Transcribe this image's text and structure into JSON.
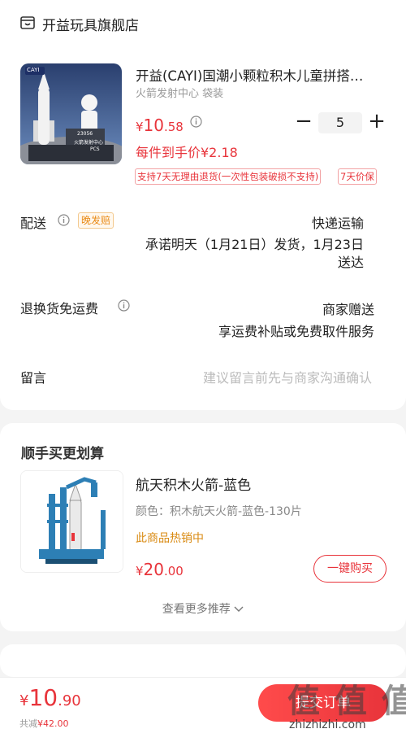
{
  "shop": {
    "name": "开益玩具旗舰店",
    "icon": "shop-icon"
  },
  "product": {
    "title": "开益(CAYI)国潮小颗粒积木儿童拼搭…",
    "spec": "火箭发射中心 袋装",
    "currency": "¥",
    "price_int": "10",
    "price_dec": ".58",
    "quantity": "5",
    "each_price": "每件到手价¥2.18",
    "badge_return": "支持7天无理由退货(一次性包装破损不支持)",
    "badge_insure": "7天价保",
    "image_text": {
      "brand": "CAYI",
      "model": "23056",
      "name": "火箭发射中心",
      "pcs": "PCS"
    }
  },
  "delivery": {
    "label": "配送",
    "late_badge": "晚发赔",
    "method": "快递运输",
    "promise_line1": "承诺明天（1月21日）发货，1月23日",
    "promise_line2": "送达"
  },
  "returns": {
    "label": "退换货免运费",
    "value": "商家赠送",
    "desc": "享运费补贴或免费取件服务"
  },
  "note": {
    "label": "留言",
    "placeholder": "建议留言前先与商家沟通确认"
  },
  "upsell": {
    "title": "顺手买更划算",
    "item": {
      "name": "航天积木火箭-蓝色",
      "spec": "颜色：积木航天火箭-蓝色-130片",
      "hot": "此商品热销中",
      "currency": "¥",
      "price_int": "20",
      "price_dec": ".00",
      "buy_label": "一键购买"
    },
    "see_more": "查看更多推荐"
  },
  "footer": {
    "currency": "¥",
    "total_int": "10",
    "total_dec": ".90",
    "discount_prefix": "共减",
    "discount_value": "¥42.00",
    "submit_label": "提交订单",
    "watermark": "值 值 值",
    "watermark_url": "zhizhizhi.com"
  },
  "colors": {
    "accent": "#e8343b",
    "hot": "#d98a12",
    "bg": "#f4f4f4"
  }
}
